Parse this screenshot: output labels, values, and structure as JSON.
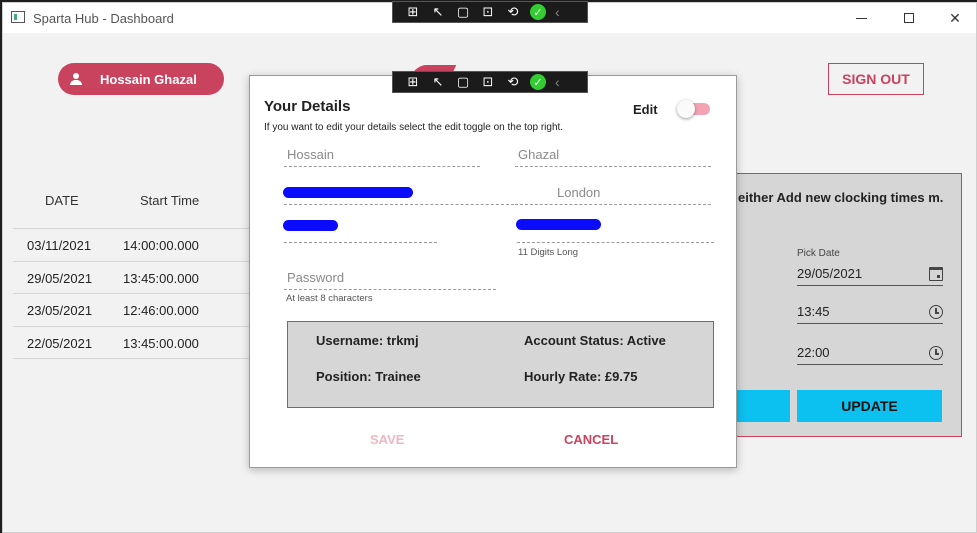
{
  "window": {
    "title": "Sparta Hub - Dashboard",
    "controls": {
      "minimize": "minimize",
      "maximize": "maximize",
      "close": "✕"
    }
  },
  "header": {
    "user_name": "Hossain Ghazal",
    "sign_out_label": "SIGN OUT"
  },
  "table": {
    "headers": [
      "DATE",
      "Start Time"
    ],
    "rows": [
      {
        "date": "03/11/2021",
        "start": "14:00:00.000"
      },
      {
        "date": "29/05/2021",
        "start": "13:45:00.000"
      },
      {
        "date": "23/05/2021",
        "start": "12:46:00.000"
      },
      {
        "date": "22/05/2021",
        "start": "13:45:00.000"
      }
    ]
  },
  "clocking_panel": {
    "instructions": "either Add new clocking times m.",
    "date_label": "Pick Date",
    "date_value": "29/05/2021",
    "start_time": "13:45",
    "end_time": "22:00",
    "update_label": "UPDATE"
  },
  "dialog": {
    "title": "Your Details",
    "subtitle": "If you want to edit your details select the edit toggle on the top right.",
    "edit_label": "Edit",
    "edit_toggle_on": false,
    "first_name_placeholder": "Hossain",
    "last_name_placeholder": "Ghazal",
    "city_placeholder": "London",
    "phone_hint": "11 Digits Long",
    "password_placeholder": "Password",
    "password_hint": "At least 8 characters",
    "info": {
      "username": "Username: trkmj",
      "account_status": "Account Status: Active",
      "position": "Position: Trainee",
      "hourly_rate": "Hourly Rate: £9.75"
    },
    "save_label": "SAVE",
    "cancel_label": "CANCEL"
  },
  "debug_toolbar": {
    "icons": [
      "live-visual-tree-icon",
      "select-element-icon",
      "display-layout-adorners-icon",
      "track-focus-icon",
      "hot-reload-icon",
      "check-icon",
      "collapse-icon"
    ],
    "check_glyph": "✓",
    "collapse_glyph": "‹"
  },
  "colors": {
    "accent": "#c9435e",
    "blue_button": "#0cc0ef",
    "panel_grey": "#d6d6d6",
    "redaction": "#0b0bff"
  }
}
